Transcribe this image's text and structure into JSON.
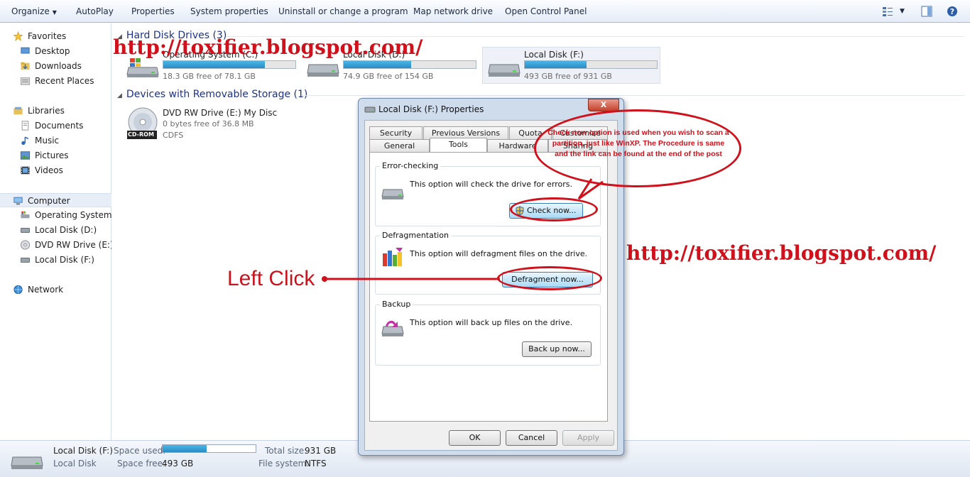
{
  "toolbar": {
    "organize": "Organize",
    "autoplay": "AutoPlay",
    "properties": "Properties",
    "system_properties": "System properties",
    "uninstall": "Uninstall or change a program",
    "map_drive": "Map network drive",
    "control_panel": "Open Control Panel"
  },
  "nav": {
    "favorites": "Favorites",
    "desktop": "Desktop",
    "downloads": "Downloads",
    "recent": "Recent Places",
    "libraries": "Libraries",
    "documents": "Documents",
    "music": "Music",
    "pictures": "Pictures",
    "videos": "Videos",
    "computer": "Computer",
    "os_drive": "Operating System (C",
    "local_d": "Local Disk (D:)",
    "dvd": "DVD RW Drive (E:) M",
    "local_f": "Local Disk (F:)",
    "network": "Network"
  },
  "content": {
    "hdd_header": "Hard Disk Drives (3)",
    "removable_header": "Devices with Removable Storage (1)",
    "drives": [
      {
        "name": "Operating System (C:)",
        "free": "18.3 GB free of 78.1 GB",
        "used_fraction": 0.77
      },
      {
        "name": "Local Disk (D:)",
        "free": "74.9 GB free of 154 GB",
        "used_fraction": 0.51
      },
      {
        "name": "Local Disk (F:)",
        "free": "493 GB free of 931 GB",
        "used_fraction": 0.47
      }
    ],
    "dvd": {
      "name": "DVD RW Drive (E:) My Disc",
      "free": "0 bytes free of 36.8 MB",
      "fs": "CDFS",
      "badge": "CD-ROM"
    }
  },
  "watermark": "http://toxifier.blogspot.com/",
  "annotation": {
    "left_click": "Left Click",
    "callout": "Check now option is used when you wish to scan a partition, just like WinXP. The Procedure is same and the link can be found at the end of the post"
  },
  "details": {
    "name": "Local Disk (F:)",
    "type": "Local Disk",
    "space_used_label": "Space used:",
    "space_free_label": "Space free:",
    "space_free": "493 GB",
    "total_label": "Total size:",
    "total": "931 GB",
    "fs_label": "File system:",
    "fs": "NTFS",
    "used_fraction": 0.47
  },
  "dialog": {
    "title": "Local Disk (F:) Properties",
    "close": "X",
    "tabs_row1": [
      "Security",
      "Previous Versions",
      "Quota",
      "Customize"
    ],
    "tabs_row2": [
      "General",
      "Tools",
      "Hardware",
      "Sharing"
    ],
    "error_title": "Error-checking",
    "error_text": "This option will check the drive for errors.",
    "check_btn": "Check now...",
    "defrag_title": "Defragmentation",
    "defrag_text": "This option will defragment files on the drive.",
    "defrag_btn": "Defragment now...",
    "backup_title": "Backup",
    "backup_text": "This option will back up files on the drive.",
    "backup_btn": "Back up now...",
    "ok": "OK",
    "cancel": "Cancel",
    "apply": "Apply"
  }
}
